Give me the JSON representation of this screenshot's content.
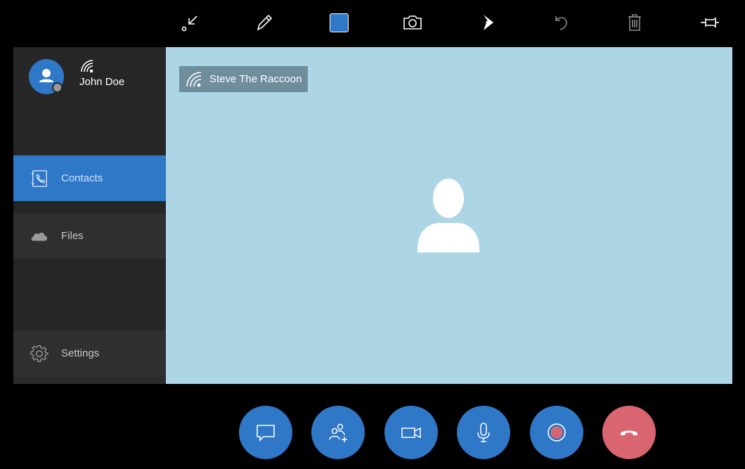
{
  "toolbar": {
    "tools": [
      {
        "name": "minimize-tool-icon"
      },
      {
        "name": "pen-icon"
      },
      {
        "name": "color-swatch"
      },
      {
        "name": "camera-icon"
      },
      {
        "name": "dynamics-icon"
      },
      {
        "name": "undo-icon"
      },
      {
        "name": "trash-icon"
      },
      {
        "name": "pin-icon"
      }
    ],
    "swatch_color": "#2f77c7"
  },
  "profile": {
    "name": "John Doe",
    "presence_color": "#9a9a9a"
  },
  "nav": {
    "contacts": "Contacts",
    "files": "Files",
    "settings": "Settings"
  },
  "call": {
    "caller_name": "Steve The Raccoon",
    "stage_color": "#acd5e5"
  },
  "callbar": {
    "buttons": [
      "chat",
      "add-participant",
      "video",
      "microphone",
      "record",
      "hang-up"
    ],
    "accent": "#2f77c7",
    "hangup_color": "#d8656f",
    "record_dot_color": "#d8656f"
  }
}
